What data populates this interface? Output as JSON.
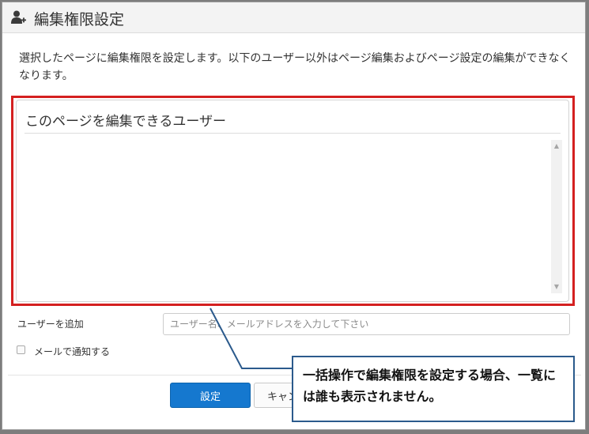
{
  "dialog": {
    "title": "編集権限設定",
    "title_icon": "user-plus-icon",
    "description": "選択したページに編集権限を設定します。以下のユーザー以外はページ編集およびページ設定の編集ができなくなります。"
  },
  "users_panel": {
    "title": "このページを編集できるユーザー",
    "scroll_up": "▲",
    "scroll_down": "▼"
  },
  "add_user": {
    "label": "ユーザーを追加",
    "placeholder": "ユーザー名、メールアドレスを入力して下さい",
    "value": ""
  },
  "notify": {
    "label": "メールで通知する",
    "checked": false
  },
  "buttons": {
    "ok_label": "設定",
    "cancel_label": "キャン"
  },
  "callout": {
    "text": "一括操作で編集権限を設定する場合、一覧には誰も表示されません。"
  },
  "colors": {
    "highlight_border": "#d42020",
    "primary_button": "#1578cf",
    "callout_border": "#2b5a8c"
  }
}
